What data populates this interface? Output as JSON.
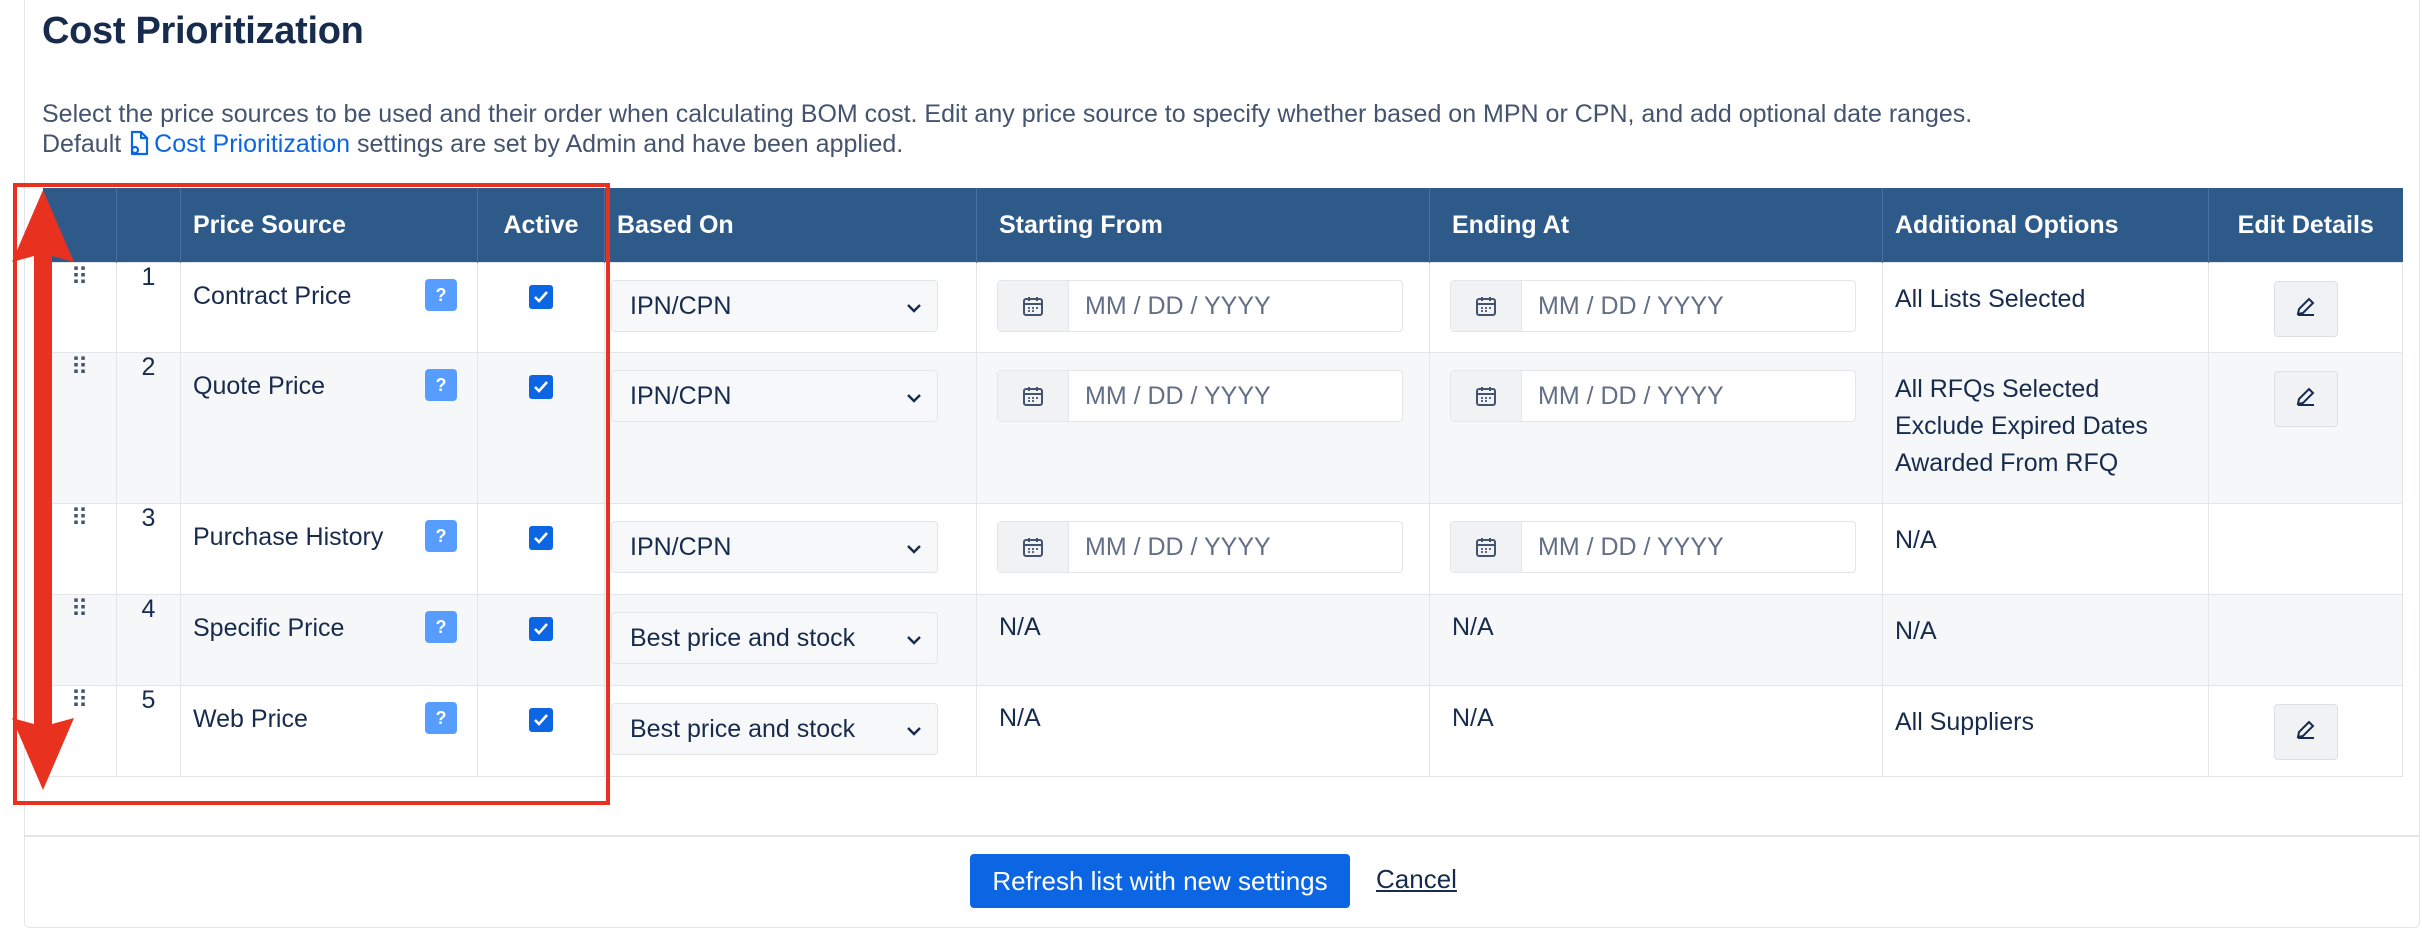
{
  "header": {
    "title": "Cost Prioritization",
    "description_line1": "Select the price sources to be used and their order when calculating BOM cost. Edit any price source to specify whether based on MPN or CPN, and add optional date ranges.",
    "description_prefix": "Default",
    "description_link": "Cost Prioritization",
    "description_suffix": "settings are set by Admin and have been applied."
  },
  "table": {
    "columns": [
      "",
      "",
      "Price Source",
      "Active",
      "Based On",
      "Starting From",
      "Ending At",
      "Additional Options",
      "Edit Details"
    ],
    "rows": [
      {
        "num": "1",
        "source": "Contract Price",
        "help": "?",
        "based_on": "IPN/CPN",
        "start": "MM / DD / YYYY",
        "end": "MM / DD / YYYY",
        "options": [
          "All Lists Selected"
        ],
        "editable": true
      },
      {
        "num": "2",
        "source": "Quote Price",
        "help": "?",
        "based_on": "IPN/CPN",
        "start": "MM / DD / YYYY",
        "end": "MM / DD / YYYY",
        "options": [
          "All RFQs Selected",
          "Exclude Expired Dates",
          "Awarded From RFQ"
        ],
        "editable": true
      },
      {
        "num": "3",
        "source": "Purchase History",
        "help": "?",
        "based_on": "IPN/CPN",
        "start": "MM / DD / YYYY",
        "end": "MM / DD / YYYY",
        "options": [
          "N/A"
        ],
        "editable": false
      },
      {
        "num": "4",
        "source": "Specific Price",
        "help": "?",
        "based_on": "Best price and stock",
        "start_na": "N/A",
        "end_na": "N/A",
        "options": [
          "N/A"
        ],
        "editable": false
      },
      {
        "num": "5",
        "source": "Web Price",
        "help": "?",
        "based_on": "Best price and stock",
        "start_na": "N/A",
        "end_na": "N/A",
        "options": [
          "All Suppliers"
        ],
        "editable": true
      }
    ]
  },
  "footer": {
    "refresh_label": "Refresh list with new settings",
    "cancel_label": "Cancel"
  },
  "colors": {
    "header_bg": "#2e5a8a",
    "accent": "#0c66e4",
    "annotation": "#e8321f"
  },
  "icons": [
    "drag-handle-icon",
    "help-icon",
    "checkbox-checked-icon",
    "chevron-down-icon",
    "calendar-icon",
    "pencil-icon",
    "document-icon"
  ]
}
